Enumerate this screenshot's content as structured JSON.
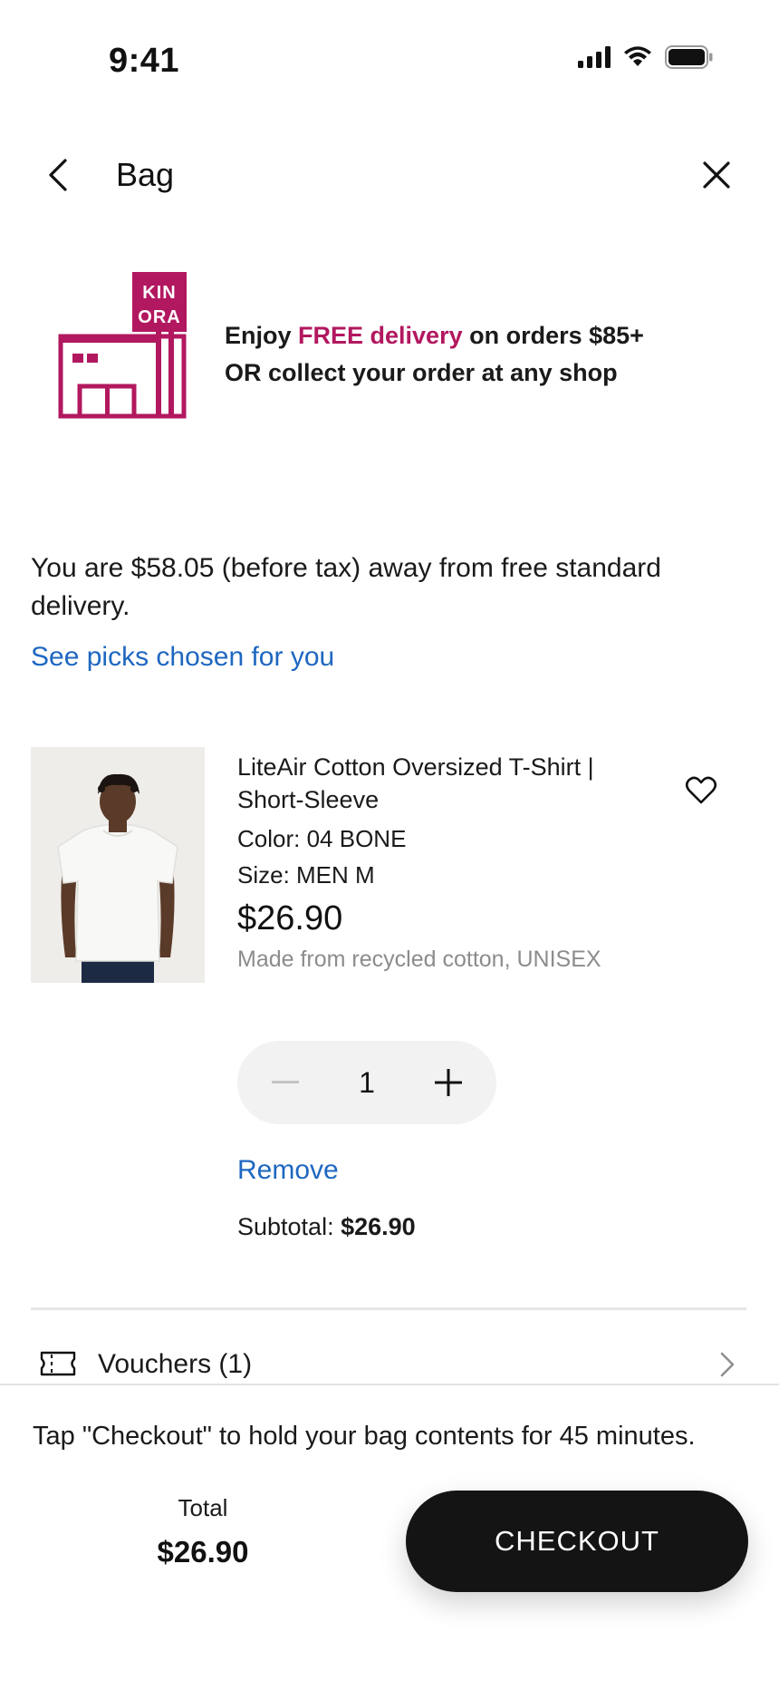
{
  "status_bar": {
    "time": "9:41",
    "icons": [
      "signal-icon",
      "wifi-icon",
      "battery-icon"
    ]
  },
  "header": {
    "title": "Bag",
    "back_icon": "chevron-left-icon",
    "close_icon": "close-icon"
  },
  "promo": {
    "logo_line1": "KIN",
    "logo_line2": "ORA",
    "text_prefix": "Enjoy ",
    "text_accent": "FREE delivery",
    "text_suffix": " on orders $85+",
    "text_line2": "OR collect your order at any shop",
    "accent_color": "#b2185f"
  },
  "delivery": {
    "message": "You are $58.05 (before tax) away from free standard delivery.",
    "link": "See picks chosen for you"
  },
  "product": {
    "name": "LiteAir Cotton Oversized T-Shirt | Short-Sleeve",
    "color": "Color: 04 BONE",
    "size": "Size: MEN M",
    "price": "$26.90",
    "note": "Made from recycled cotton, UNISEX",
    "quantity": "1",
    "remove_label": "Remove",
    "subtotal_label": "Subtotal: ",
    "subtotal_value": "$26.90"
  },
  "vouchers": {
    "label": "Vouchers (1)"
  },
  "footer": {
    "hold_message": "Tap \"Checkout\" to hold your bag contents for 45 minutes.",
    "total_label": "Total",
    "total_value": "$26.90",
    "checkout_label": "CHECKOUT"
  },
  "colors": {
    "link": "#1e67c0",
    "brand": "#b2185f",
    "button_dark": "#141414"
  }
}
